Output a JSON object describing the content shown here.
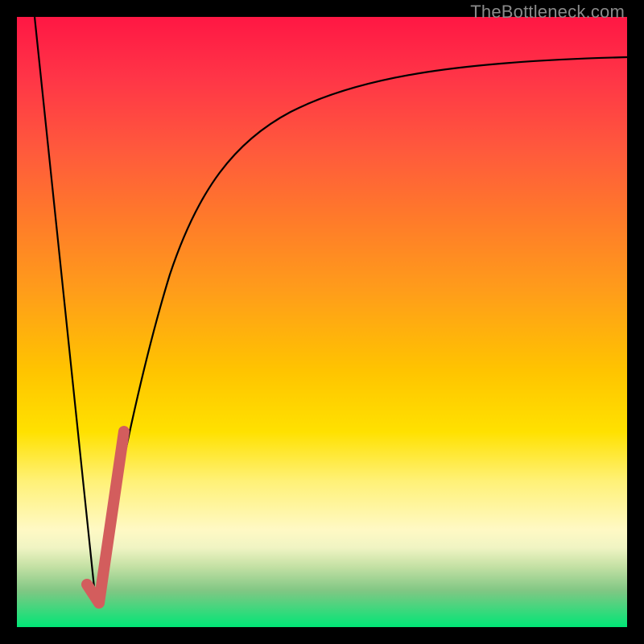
{
  "watermark": "TheBottleneck.com",
  "chart_data": {
    "type": "line",
    "title": "",
    "xlabel": "",
    "ylabel": "",
    "xlim": [
      0,
      100
    ],
    "ylim": [
      0,
      100
    ],
    "grid": false,
    "legend": false,
    "series": [
      {
        "name": "descending-line",
        "type": "line",
        "color": "#000000",
        "x": [
          3,
          13
        ],
        "y": [
          100,
          4
        ]
      },
      {
        "name": "rising-curve",
        "type": "line",
        "color": "#000000",
        "x": [
          13,
          16,
          20,
          25,
          30,
          35,
          40,
          50,
          60,
          70,
          80,
          90,
          100
        ],
        "y": [
          4,
          20,
          40,
          58,
          69,
          76,
          80,
          85,
          88,
          90,
          91.5,
          92.5,
          93
        ]
      },
      {
        "name": "highlight-hook",
        "type": "line",
        "color": "#d35d5d",
        "stroke_width_px": 14,
        "linecap": "round",
        "x": [
          11.5,
          13.5,
          17.5
        ],
        "y": [
          7,
          4,
          32
        ]
      }
    ]
  }
}
